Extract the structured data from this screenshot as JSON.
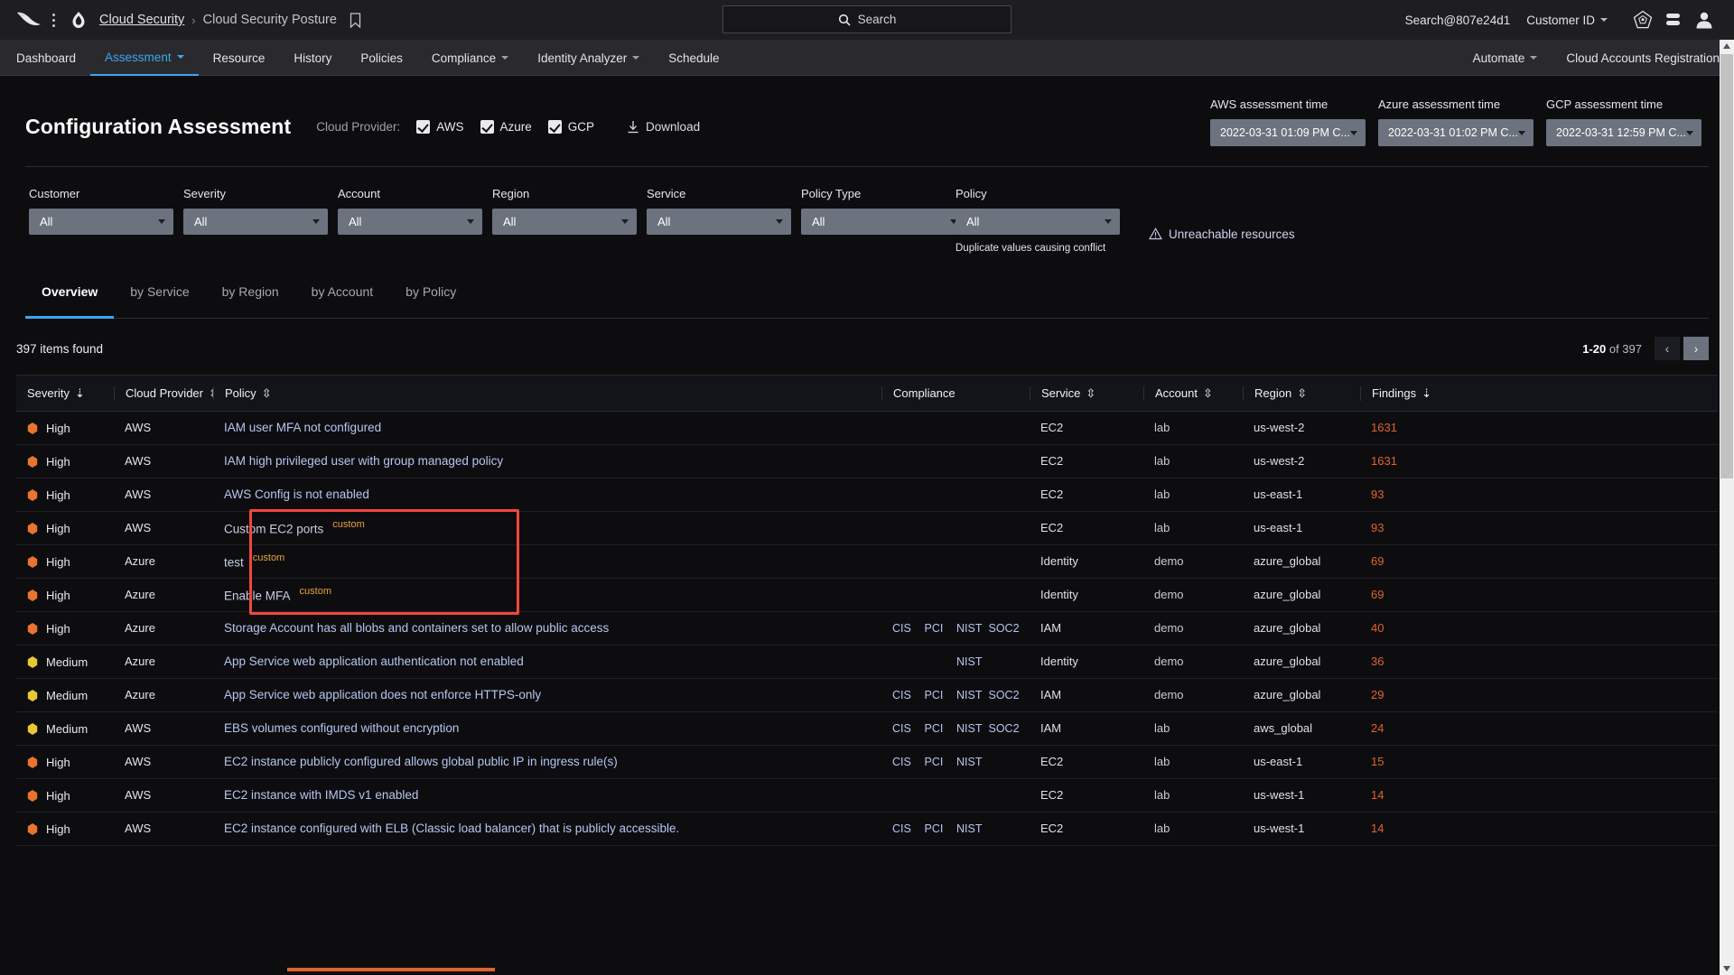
{
  "topbar": {
    "breadcrumb": {
      "root": "Cloud Security",
      "separator": "›",
      "current": "Cloud Security Posture"
    },
    "search": {
      "placeholder": "Search"
    },
    "account": "Search@807e24d1",
    "customer_id_label": "Customer ID",
    "icons": [
      "falcon-logo-icon",
      "kebab-menu-icon",
      "cloud-shield-icon",
      "bookmark-icon",
      "search-icon",
      "support-icon",
      "notifications-icon",
      "user-avatar-icon"
    ]
  },
  "nav": {
    "items": [
      {
        "label": "Dashboard",
        "caret": false,
        "active": false
      },
      {
        "label": "Assessment",
        "caret": true,
        "active": true
      },
      {
        "label": "Resource",
        "caret": false,
        "active": false
      },
      {
        "label": "History",
        "caret": false,
        "active": false
      },
      {
        "label": "Policies",
        "caret": false,
        "active": false
      },
      {
        "label": "Compliance",
        "caret": true,
        "active": false
      },
      {
        "label": "Identity Analyzer",
        "caret": true,
        "active": false
      },
      {
        "label": "Schedule",
        "caret": false,
        "active": false
      }
    ],
    "right_items": [
      {
        "label": "Automate",
        "caret": true
      },
      {
        "label": "Cloud Accounts Registration",
        "caret": false
      }
    ]
  },
  "header": {
    "title": "Configuration Assessment",
    "cloud_provider_label": "Cloud Provider:",
    "providers": [
      {
        "label": "AWS",
        "checked": true
      },
      {
        "label": "Azure",
        "checked": true
      },
      {
        "label": "GCP",
        "checked": true
      }
    ],
    "download_label": "Download",
    "assessment_times": [
      {
        "label": "AWS assessment time",
        "value": "2022-03-31 01:09 PM C..."
      },
      {
        "label": "Azure assessment time",
        "value": "2022-03-31 01:02 PM C..."
      },
      {
        "label": "GCP assessment time",
        "value": "2022-03-31 12:59 PM C..."
      }
    ]
  },
  "filters": {
    "fields": [
      {
        "label": "Customer",
        "value": "All"
      },
      {
        "label": "Severity",
        "value": "All"
      },
      {
        "label": "Account",
        "value": "All"
      },
      {
        "label": "Region",
        "value": "All"
      },
      {
        "label": "Service",
        "value": "All"
      },
      {
        "label": "Policy Type",
        "value": "All"
      },
      {
        "label": "Policy",
        "value": "All",
        "note": "Duplicate values causing conflict"
      }
    ],
    "unreachable_label": "Unreachable resources"
  },
  "tabs": [
    {
      "label": "Overview",
      "active": true
    },
    {
      "label": "by Service",
      "active": false
    },
    {
      "label": "by Region",
      "active": false
    },
    {
      "label": "by Account",
      "active": false
    },
    {
      "label": "by Policy",
      "active": false
    }
  ],
  "results": {
    "items_found": "397 items found",
    "range": "1-20",
    "of_text": "of 397",
    "prev_glyph": "‹",
    "next_glyph": "›"
  },
  "table": {
    "columns": [
      {
        "key": "severity",
        "label": "Severity",
        "sort": "desc"
      },
      {
        "key": "cloud_provider",
        "label": "Cloud Provider",
        "sort": "both"
      },
      {
        "key": "policy",
        "label": "Policy",
        "sort": "both"
      },
      {
        "key": "compliance",
        "label": "Compliance",
        "sort": "none"
      },
      {
        "key": "service",
        "label": "Service",
        "sort": "both"
      },
      {
        "key": "account",
        "label": "Account",
        "sort": "both"
      },
      {
        "key": "region",
        "label": "Region",
        "sort": "both"
      },
      {
        "key": "findings",
        "label": "Findings",
        "sort": "desc"
      }
    ],
    "rows": [
      {
        "severity": "High",
        "sev_color": "#e8742e",
        "cloud_provider": "AWS",
        "policy": "IAM user MFA not configured",
        "custom": false,
        "link": true,
        "compliance": [],
        "service": "EC2",
        "account": "lab",
        "region": "us-west-2",
        "findings": "1631"
      },
      {
        "severity": "High",
        "sev_color": "#e8742e",
        "cloud_provider": "AWS",
        "policy": "IAM high privileged user with group managed policy",
        "custom": false,
        "link": true,
        "compliance": [],
        "service": "EC2",
        "account": "lab",
        "region": "us-west-2",
        "findings": "1631"
      },
      {
        "severity": "High",
        "sev_color": "#e8742e",
        "cloud_provider": "AWS",
        "policy": "AWS Config is not enabled",
        "custom": false,
        "link": true,
        "compliance": [],
        "service": "EC2",
        "account": "lab",
        "region": "us-east-1",
        "findings": "93"
      },
      {
        "severity": "High",
        "sev_color": "#e8742e",
        "cloud_provider": "AWS",
        "policy": "Custom EC2 ports",
        "custom": true,
        "link": false,
        "compliance": [],
        "service": "EC2",
        "account": "lab",
        "region": "us-east-1",
        "findings": "93"
      },
      {
        "severity": "High",
        "sev_color": "#e8742e",
        "cloud_provider": "Azure",
        "policy": "test",
        "custom": true,
        "link": false,
        "compliance": [],
        "service": "Identity",
        "account": "demo",
        "region": "azure_global",
        "findings": "69"
      },
      {
        "severity": "High",
        "sev_color": "#e8742e",
        "cloud_provider": "Azure",
        "policy": "Enable MFA",
        "custom": true,
        "link": false,
        "compliance": [],
        "service": "Identity",
        "account": "demo",
        "region": "azure_global",
        "findings": "69"
      },
      {
        "severity": "High",
        "sev_color": "#e8742e",
        "cloud_provider": "Azure",
        "policy": "Storage Account has all blobs and containers set to allow public access",
        "custom": false,
        "link": true,
        "compliance": [
          "CIS",
          "PCI",
          "NIST",
          "SOC2"
        ],
        "service": "IAM",
        "account": "demo",
        "region": "azure_global",
        "findings": "40"
      },
      {
        "severity": "Medium",
        "sev_color": "#e8c832",
        "cloud_provider": "Azure",
        "policy": "App Service web application authentication not enabled",
        "custom": false,
        "link": true,
        "compliance": [
          "",
          "",
          "NIST",
          ""
        ],
        "service": "Identity",
        "account": "demo",
        "region": "azure_global",
        "findings": "36"
      },
      {
        "severity": "Medium",
        "sev_color": "#e8c832",
        "cloud_provider": "Azure",
        "policy": "App Service web application does not enforce HTTPS-only",
        "custom": false,
        "link": true,
        "compliance": [
          "CIS",
          "PCI",
          "NIST",
          "SOC2"
        ],
        "service": "IAM",
        "account": "demo",
        "region": "azure_global",
        "findings": "29"
      },
      {
        "severity": "Medium",
        "sev_color": "#e8c832",
        "cloud_provider": "AWS",
        "policy": "EBS volumes configured without encryption",
        "custom": false,
        "link": true,
        "compliance": [
          "CIS",
          "PCI",
          "NIST",
          "SOC2"
        ],
        "service": "IAM",
        "account": "lab",
        "region": "aws_global",
        "findings": "24"
      },
      {
        "severity": "High",
        "sev_color": "#e8742e",
        "cloud_provider": "AWS",
        "policy": "EC2 instance publicly configured allows global public IP in ingress rule(s)",
        "custom": false,
        "link": true,
        "compliance": [
          "CIS",
          "PCI",
          "NIST",
          ""
        ],
        "service": "EC2",
        "account": "lab",
        "region": "us-east-1",
        "findings": "15"
      },
      {
        "severity": "High",
        "sev_color": "#e8742e",
        "cloud_provider": "AWS",
        "policy": "EC2 instance with IMDS v1 enabled",
        "custom": false,
        "link": true,
        "compliance": [],
        "service": "EC2",
        "account": "lab",
        "region": "us-west-1",
        "findings": "14"
      },
      {
        "severity": "High",
        "sev_color": "#e8742e",
        "cloud_provider": "AWS",
        "policy": "EC2 instance configured with ELB (Classic load balancer) that is publicly accessible.",
        "custom": false,
        "link": true,
        "compliance": [
          "CIS",
          "PCI",
          "NIST",
          ""
        ],
        "service": "EC2",
        "account": "lab",
        "region": "us-west-1",
        "findings": "14"
      }
    ],
    "custom_badge_label": "custom"
  },
  "annotation": {
    "color": "#f4453e"
  },
  "colors": {
    "accent_blue": "#3ba6f0",
    "link_blue": "#b6c6ef",
    "findings_orange": "#e0622c",
    "severity_high": "#e8742e",
    "severity_medium": "#e8c832",
    "custom_badge": "#e8a33d",
    "page_bg": "#0d0d10",
    "topbar_bg": "#1e1e21",
    "navbar_bg": "#2a2a2e",
    "select_bg": "#6c737e"
  }
}
